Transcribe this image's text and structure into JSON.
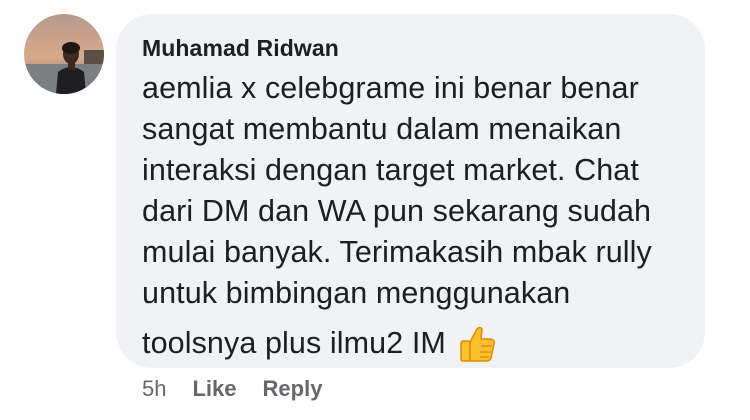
{
  "comment": {
    "author": "Muhamad Ridwan",
    "lines": [
      "aemlia x celebgrame ini benar benar",
      "sangat membantu dalam menaikan",
      "interaksi dengan target market. Chat",
      "dari DM dan WA pun sekarang sudah",
      "mulai banyak. Terimakasih mbak rully",
      "untuk bimbingan menggunakan",
      "toolsnya plus ilmu2 IM"
    ],
    "emoji": "thumbs-up-emoji",
    "bubble_color": "#f0f2f5",
    "text_color": "#1c1e21"
  },
  "actions": {
    "time": "5h",
    "like_label": "Like",
    "reply_label": "Reply",
    "color": "#65676b"
  }
}
